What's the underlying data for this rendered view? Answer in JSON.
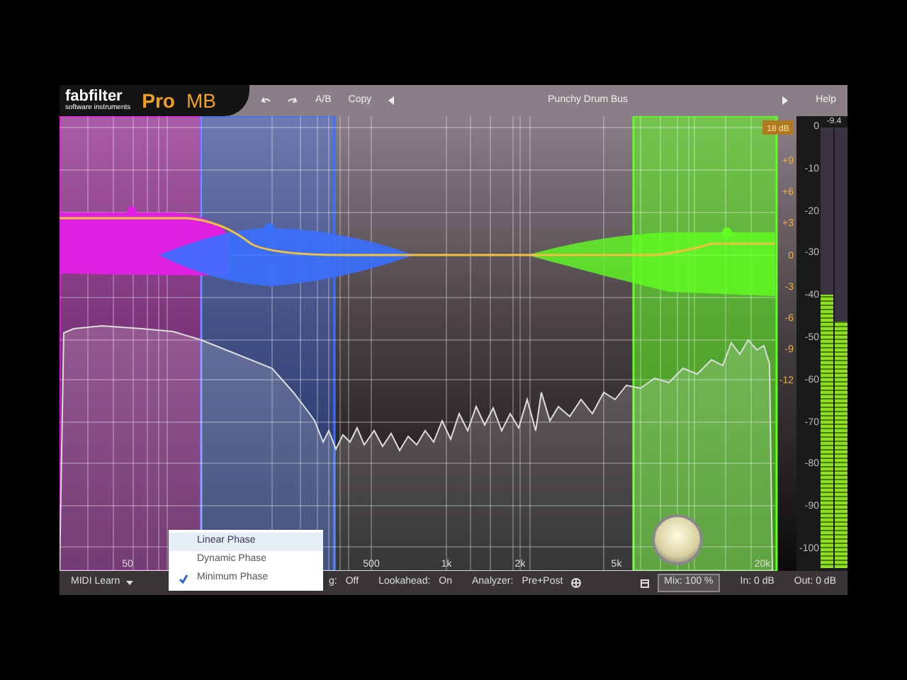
{
  "header": {
    "brand": "fabfilter",
    "brand_sub": "software instruments",
    "product": "Pro",
    "product_suffix": "MB",
    "ab": "A/B",
    "copy": "Copy",
    "preset": "Punchy Drum Bus",
    "help": "Help"
  },
  "graph": {
    "range_badge": "18 dB",
    "bands": [
      {
        "color": "#e020e0",
        "selected": false
      },
      {
        "color": "#3a70ff",
        "selected": false
      },
      {
        "color": "#60ff20",
        "selected": true
      }
    ],
    "freq_labels": [
      "50",
      "500",
      "1k",
      "2k",
      "5k",
      "20k"
    ],
    "gain_labels": [
      "+9",
      "+6",
      "+3",
      "0",
      "-3",
      "-6",
      "-9",
      "-12"
    ],
    "db_labels": [
      "0",
      "-10",
      "-20",
      "-30",
      "-40",
      "-50",
      "-60",
      "-70",
      "-80",
      "-90",
      "-100"
    ]
  },
  "meter": {
    "peak": "-9.4",
    "channels": [
      {
        "level": 0.62
      },
      {
        "level": 0.56
      }
    ]
  },
  "phase_menu": [
    {
      "label": "Linear Phase",
      "selected": true,
      "checked": false
    },
    {
      "label": "Dynamic Phase",
      "selected": false,
      "checked": false
    },
    {
      "label": "Minimum Phase",
      "selected": false,
      "checked": true
    }
  ],
  "footer": {
    "midi": "MIDI Learn",
    "partial": "g:",
    "partial_value": "Off",
    "lookahead_label": "Lookahead:",
    "lookahead": "On",
    "analyzer_label": "Analyzer:",
    "analyzer": "Pre+Post",
    "mix": "Mix: 100 %",
    "in": "In: 0 dB",
    "out": "Out: 0 dB"
  }
}
